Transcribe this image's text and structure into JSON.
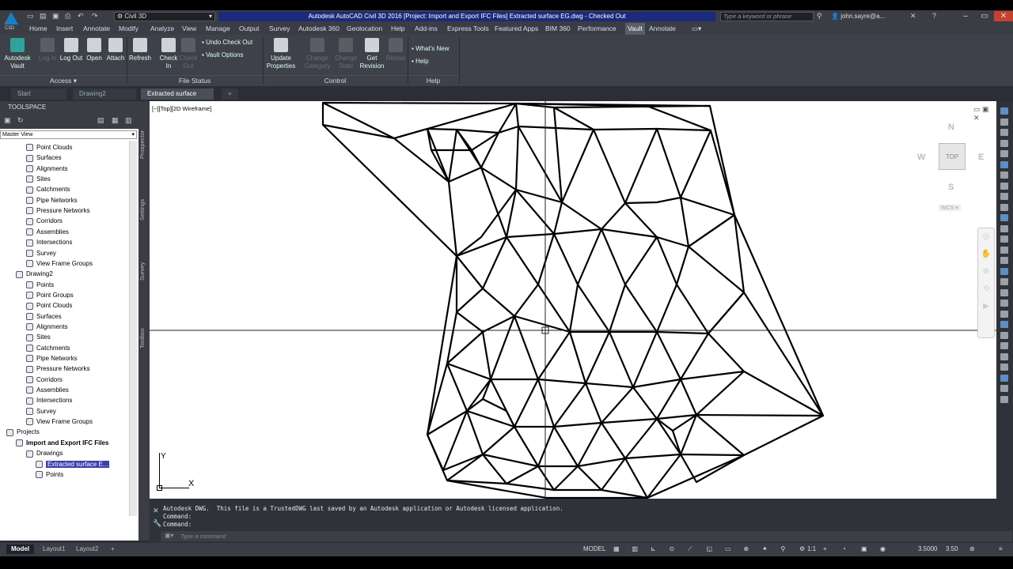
{
  "app": {
    "workspace": "Civil 3D",
    "title": "Autodesk AutoCAD Civil 3D 2016 [Project: Import and Export IFC Files]   Extracted surface EG.dwg - Checked Out",
    "search_placeholder": "Type a keyword or phrase",
    "user": "john.sayre@a...",
    "logo_sub": "C3D"
  },
  "menu_tabs": [
    "Home",
    "Insert",
    "Annotate",
    "Modify",
    "Analyze",
    "View",
    "Manage",
    "Output",
    "Survey",
    "Autodesk 360",
    "Geolocation",
    "Help",
    "Add-ins",
    "Express Tools",
    "Featured Apps",
    "BIM 360",
    "Performance",
    "Vault",
    "Annotate"
  ],
  "active_tab": "Vault",
  "ribbon": {
    "buttons": [
      {
        "label": "Autodesk\nVault",
        "enabled": true
      },
      {
        "label": "Log in",
        "enabled": false
      },
      {
        "label": "Log Out",
        "enabled": true
      },
      {
        "label": "Open",
        "enabled": true
      },
      {
        "label": "Attach",
        "enabled": true
      },
      {
        "label": "Refresh",
        "enabled": true
      },
      {
        "label": "Check\nIn",
        "enabled": true
      },
      {
        "label": "Check\nOut",
        "enabled": false
      },
      {
        "label": "Undo Check Out",
        "enabled": true
      },
      {
        "label": "Vault Options",
        "enabled": true
      },
      {
        "label": "Update\nProperties",
        "enabled": true
      },
      {
        "label": "Change\nCategory",
        "enabled": false
      },
      {
        "label": "Change\nState",
        "enabled": false
      },
      {
        "label": "Get\nRevision",
        "enabled": true
      },
      {
        "label": "Revise",
        "enabled": false
      },
      {
        "label": "What's New",
        "enabled": true
      },
      {
        "label": "Help",
        "enabled": true
      }
    ],
    "panels": [
      "Access",
      "File Status",
      "Control",
      "Help"
    ]
  },
  "doc_tabs": [
    "Start",
    "Drawing2",
    "Extracted surface EG"
  ],
  "active_doc": "Extracted surface EG",
  "toolspace": {
    "title": "TOOLSPACE",
    "view": "Master View",
    "side_tabs": [
      "Prospector",
      "Settings",
      "Survey",
      "Toolbox"
    ],
    "tree": [
      {
        "label": "Point Clouds",
        "level": 3
      },
      {
        "label": "Surfaces",
        "level": 3
      },
      {
        "label": "Alignments",
        "level": 3
      },
      {
        "label": "Sites",
        "level": 3
      },
      {
        "label": "Catchments",
        "level": 3
      },
      {
        "label": "Pipe Networks",
        "level": 3
      },
      {
        "label": "Pressure Networks",
        "level": 3
      },
      {
        "label": "Corridors",
        "level": 3
      },
      {
        "label": "Assemblies",
        "level": 3
      },
      {
        "label": "Intersections",
        "level": 3
      },
      {
        "label": "Survey",
        "level": 3
      },
      {
        "label": "View Frame Groups",
        "level": 3
      },
      {
        "label": "Drawing2",
        "level": 2
      },
      {
        "label": "Points",
        "level": 3
      },
      {
        "label": "Point Groups",
        "level": 3
      },
      {
        "label": "Point Clouds",
        "level": 3
      },
      {
        "label": "Surfaces",
        "level": 3
      },
      {
        "label": "Alignments",
        "level": 3
      },
      {
        "label": "Sites",
        "level": 3
      },
      {
        "label": "Catchments",
        "level": 3
      },
      {
        "label": "Pipe Networks",
        "level": 3
      },
      {
        "label": "Pressure Networks",
        "level": 3
      },
      {
        "label": "Corridors",
        "level": 3
      },
      {
        "label": "Assemblies",
        "level": 3
      },
      {
        "label": "Intersections",
        "level": 3
      },
      {
        "label": "Survey",
        "level": 3
      },
      {
        "label": "View Frame Groups",
        "level": 3
      },
      {
        "label": "Projects",
        "level": 1
      },
      {
        "label": "Import and Export IFC Files",
        "level": 2,
        "bold": true
      },
      {
        "label": "Drawings",
        "level": 3
      },
      {
        "label": "Extracted surface E...",
        "level": 4,
        "selected": true
      },
      {
        "label": "Points",
        "level": 4
      }
    ]
  },
  "viewport": {
    "label": "[−][Top][2D Wireframe]",
    "cube": {
      "n": "N",
      "s": "S",
      "e": "E",
      "w": "W",
      "face": "TOP",
      "wcs": "WCS"
    },
    "ucs": {
      "x": "X",
      "y": "Y"
    }
  },
  "command": {
    "history": [
      "Autodesk DWG.  This file is a TrustedDWG last saved by an Autodesk application or Autodesk licensed application.",
      "Command:",
      "Command:"
    ],
    "placeholder": "Type a command"
  },
  "layouts": [
    "Model",
    "Layout1",
    "Layout2"
  ],
  "status": {
    "space": "MODEL",
    "scale": "1:1",
    "value1": "3.5000",
    "value2": "3.50"
  }
}
